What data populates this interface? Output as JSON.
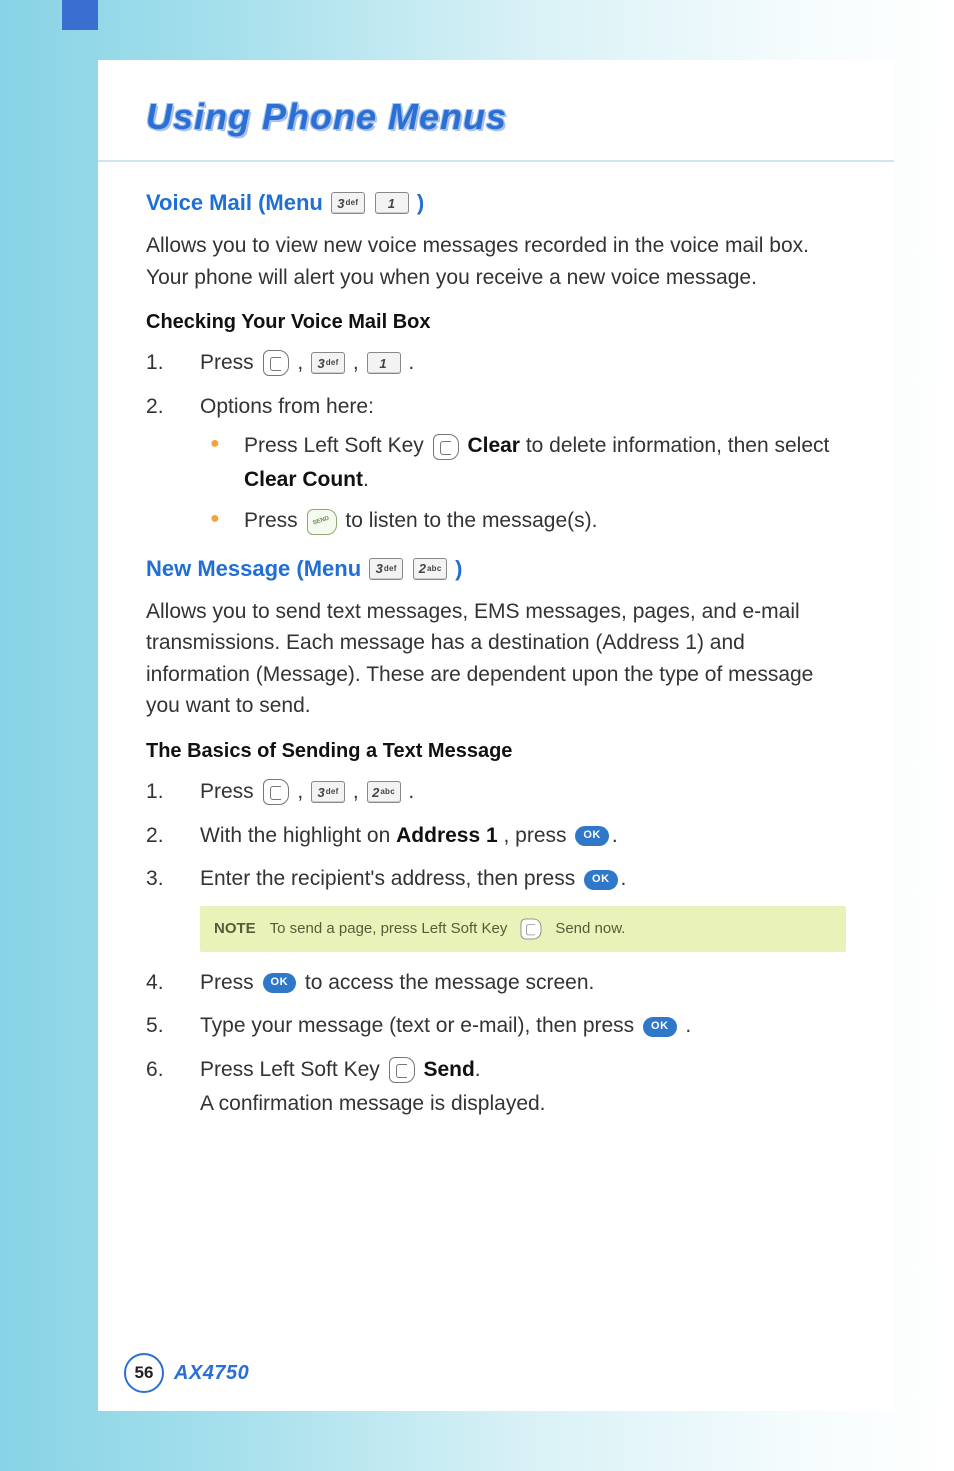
{
  "section_title": "Using Phone Menus",
  "voice_mail": {
    "heading_prefix": "Voice Mail (Menu ",
    "heading_suffix": " )",
    "key3": {
      "num": "3",
      "sub": "def"
    },
    "key1": {
      "num": "1",
      "sub": ""
    },
    "intro": "Allows you to view new voice messages recorded in the voice mail box. Your phone will alert you when you receive a new voice message.",
    "check_heading": "Checking Your Voice Mail Box",
    "step1_prefix": "Press ",
    "step1_sep": " , ",
    "step1_end": " .",
    "step2": "Options from here:",
    "opt1_prefix": "Press Left Soft Key ",
    "opt1_bold1": "Clear",
    "opt1_mid": " to delete information, then select ",
    "opt1_bold2": "Clear Count",
    "opt1_end": ".",
    "opt2_prefix": "Press ",
    "opt2_suffix": " to listen to the message(s)."
  },
  "new_msg": {
    "heading_prefix": "New Message (Menu ",
    "heading_suffix": " )",
    "key3": {
      "num": "3",
      "sub": "def"
    },
    "key2": {
      "num": "2",
      "sub": "abc"
    },
    "intro": "Allows you to send text messages, EMS messages, pages, and e-mail transmissions. Each message has a destination (Address 1) and information (Message). These are dependent upon the type of message you want to send.",
    "basics_heading": "The Basics of Sending a Text Message",
    "s1_prefix": "Press ",
    "s1_sep": " , ",
    "s1_end": " .",
    "s2_prefix": "With the highlight on ",
    "s2_bold": "Address 1",
    "s2_mid": ", press ",
    "s2_end": ".",
    "s3_prefix": "Enter the recipient's address, then press ",
    "s3_end": ".",
    "s4_prefix": "Press ",
    "s4_suffix": " to access the message screen.",
    "s5_prefix": "Type your message (text or e-mail), then press ",
    "s5_end": " .",
    "s6_prefix": "Press Left Soft Key ",
    "s6_bold": "Send",
    "s6_mid": ".",
    "s6_line2": "A confirmation message is displayed."
  },
  "note": {
    "label": "NOTE",
    "t1": "To send a page, press Left Soft Key",
    "t2": "Send now."
  },
  "ok_label": "OK",
  "footer": {
    "page": "56",
    "model": "AX4750"
  }
}
